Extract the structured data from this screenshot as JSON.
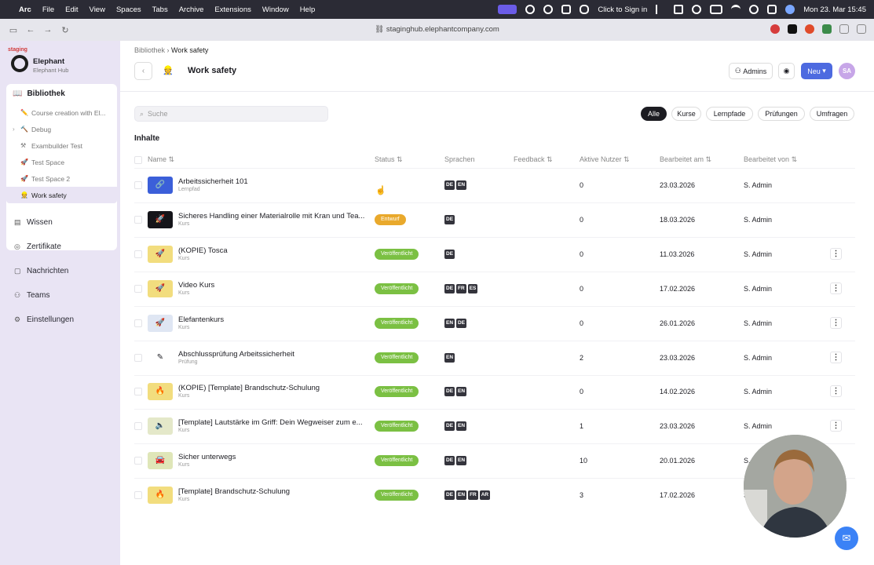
{
  "menubar": {
    "apple": "",
    "app": "Arc",
    "items": [
      "File",
      "Edit",
      "View",
      "Spaces",
      "Tabs",
      "Archive",
      "Extensions",
      "Window",
      "Help"
    ],
    "sign_in": "Click to Sign in",
    "clock": "Mon 23. Mar  15:45"
  },
  "browser": {
    "url": "staginghub.elephantcompany.com"
  },
  "sidebar": {
    "env_label": "staging",
    "brand_name": "Elephant",
    "brand_sub": "Elephant Hub",
    "library_label": "Bibliothek",
    "library_items": [
      {
        "icon": "✏️",
        "label": "Course creation with El..."
      },
      {
        "icon": "🔨",
        "label": "Debug"
      },
      {
        "icon": "⚒",
        "label": "Exambuilder Test"
      },
      {
        "icon": "🚀",
        "label": "Test Space"
      },
      {
        "icon": "🚀",
        "label": "Test Space 2"
      },
      {
        "icon": "👷",
        "label": "Work safety"
      }
    ],
    "nav": [
      {
        "icon": "book-icon",
        "label": "Wissen"
      },
      {
        "icon": "certificate-icon",
        "label": "Zertifikate"
      },
      {
        "icon": "message-icon",
        "label": "Nachrichten"
      },
      {
        "icon": "team-icon",
        "label": "Teams"
      },
      {
        "icon": "gear-icon",
        "label": "Einstellungen"
      }
    ]
  },
  "header": {
    "breadcrumb_root": "Bibliothek",
    "breadcrumb_current": "Work safety",
    "title_icon": "👷",
    "title": "Work safety",
    "admins_label": "Admins",
    "new_label": "Neu",
    "avatar": "SA"
  },
  "toolbar": {
    "search_placeholder": "Suche",
    "filters": [
      "Alle",
      "Kurse",
      "Lernpfade",
      "Prüfungen",
      "Umfragen"
    ]
  },
  "section_title": "Inhalte",
  "table": {
    "headers": {
      "name": "Name",
      "status": "Status",
      "languages": "Sprachen",
      "feedback": "Feedback",
      "active_users": "Aktive Nutzer",
      "edited_at": "Bearbeitet am",
      "edited_by": "Bearbeitet von"
    },
    "rows": [
      {
        "name": "Arbeitssicherheit 101",
        "type": "Lernpfad",
        "status": "",
        "langs": [
          "DE",
          "EN"
        ],
        "users": "0",
        "date": "23.03.2026",
        "editor": "S. Admin",
        "thumb": "🔗",
        "thumb_bg": "#3b5fd9",
        "menu": false
      },
      {
        "name": "Sicheres Handling einer Materialrolle mit Kran und Tea...",
        "type": "Kurs",
        "status": "Entwurf",
        "langs": [
          "DE"
        ],
        "users": "0",
        "date": "18.03.2026",
        "editor": "S. Admin",
        "thumb": "🚀",
        "thumb_bg": "#15151a",
        "menu": false
      },
      {
        "name": "(KOPIE) Tosca",
        "type": "Kurs",
        "status": "Veröffentlicht",
        "langs": [
          "DE"
        ],
        "users": "0",
        "date": "11.03.2026",
        "editor": "S. Admin",
        "thumb": "🚀",
        "thumb_bg": "#f2dd7e",
        "menu": true
      },
      {
        "name": "Video Kurs",
        "type": "Kurs",
        "status": "Veröffentlicht",
        "langs": [
          "DE",
          "FR",
          "ES"
        ],
        "users": "0",
        "date": "17.02.2026",
        "editor": "S. Admin",
        "thumb": "🚀",
        "thumb_bg": "#f2dd7e",
        "menu": true
      },
      {
        "name": "Elefantenkurs",
        "type": "Kurs",
        "status": "Veröffentlicht",
        "langs": [
          "EN",
          "DE"
        ],
        "users": "0",
        "date": "26.01.2026",
        "editor": "S. Admin",
        "thumb": "🚀",
        "thumb_bg": "#dfe6f3",
        "menu": true
      },
      {
        "name": "Abschlussprüfung Arbeitssicherheit",
        "type": "Prüfung",
        "status": "Veröffentlicht",
        "langs": [
          "EN"
        ],
        "users": "2",
        "date": "23.03.2026",
        "editor": "S. Admin",
        "thumb": "✎",
        "thumb_bg": "#ffffff",
        "menu": true
      },
      {
        "name": "(KOPIE) [Template] Brandschutz-Schulung",
        "type": "Kurs",
        "status": "Veröffentlicht",
        "langs": [
          "DE",
          "EN"
        ],
        "users": "0",
        "date": "14.02.2026",
        "editor": "S. Admin",
        "thumb": "🔥",
        "thumb_bg": "#f2dd7e",
        "menu": true
      },
      {
        "name": "[Template] Lautstärke im Griff: Dein Wegweiser zum e...",
        "type": "Kurs",
        "status": "Veröffentlicht",
        "langs": [
          "DE",
          "EN"
        ],
        "users": "1",
        "date": "23.03.2026",
        "editor": "S. Admin",
        "thumb": "🔈",
        "thumb_bg": "#e4e8c9",
        "menu": true
      },
      {
        "name": "Sicher unterwegs",
        "type": "Kurs",
        "status": "Veröffentlicht",
        "langs": [
          "DE",
          "EN"
        ],
        "users": "10",
        "date": "20.01.2026",
        "editor": "S.",
        "thumb": "🚘",
        "thumb_bg": "#dfe6b8",
        "menu": false
      },
      {
        "name": "[Template] Brandschutz-Schulung",
        "type": "Kurs",
        "status": "Veröffentlicht",
        "langs": [
          "DE",
          "EN",
          "FR",
          "AR"
        ],
        "users": "3",
        "date": "17.02.2026",
        "editor": "S.",
        "thumb": "🔥",
        "thumb_bg": "#f2dd7e",
        "menu": false
      }
    ]
  }
}
